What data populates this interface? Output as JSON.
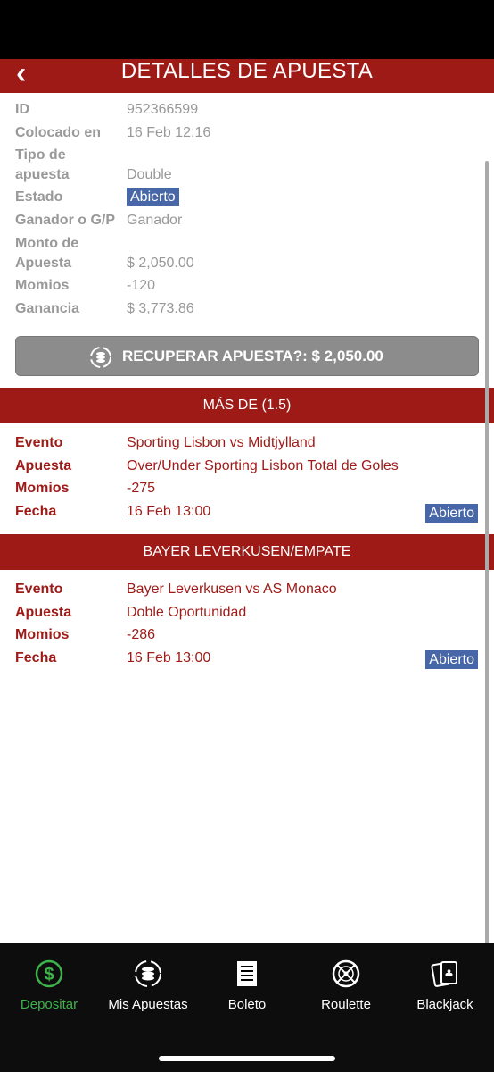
{
  "header": {
    "back_icon": "chevron-left-icon",
    "title": "DETALLES DE APUESTA"
  },
  "details": {
    "id_label": "ID",
    "id_value": "952366599",
    "placed_label": "Colocado en",
    "placed_value": "16 Feb 12:16",
    "type_label_1": "Tipo de",
    "type_label_2": "apuesta",
    "type_value": "Double",
    "status_label": "Estado",
    "status_value": "Abierto",
    "winner_label": "Ganador o G/P",
    "winner_value": "Ganador",
    "amount_label_1": "Monto de",
    "amount_label_2": "Apuesta",
    "amount_value": "$ 2,050.00",
    "odds_label": "Momios",
    "odds_value": "-120",
    "profit_label": "Ganancia",
    "profit_value": "$ 3,773.86"
  },
  "recover_button": {
    "label": "RECUPERAR APUESTA?: $ 2,050.00",
    "icon": "coins-refresh-icon"
  },
  "legs": [
    {
      "header": "MÁS DE (1.5)",
      "event_label": "Evento",
      "event_value": "Sporting Lisbon vs Midtjylland",
      "bet_label": "Apuesta",
      "bet_value": "Over/Under Sporting Lisbon Total de Goles",
      "odds_label": "Momios",
      "odds_value": "-275",
      "date_label": "Fecha",
      "date_value": "16 Feb 13:00",
      "status": "Abierto"
    },
    {
      "header": "BAYER LEVERKUSEN/EMPATE",
      "event_label": "Evento",
      "event_value": "Bayer Leverkusen vs AS Monaco",
      "bet_label": "Apuesta",
      "bet_value": "Doble Oportunidad",
      "odds_label": "Momios",
      "odds_value": "-286",
      "date_label": "Fecha",
      "date_value": "16 Feb 13:00",
      "status": "Abierto"
    }
  ],
  "tabbar": [
    {
      "label": "Depositar",
      "icon": "dollar-circle-icon",
      "active": true
    },
    {
      "label": "Mis Apuestas",
      "icon": "coins-refresh-icon",
      "active": false
    },
    {
      "label": "Boleto",
      "icon": "ticket-list-icon",
      "active": false
    },
    {
      "label": "Roulette",
      "icon": "roulette-wheel-icon",
      "active": false
    },
    {
      "label": "Blackjack",
      "icon": "playing-cards-icon",
      "active": false
    }
  ],
  "colors": {
    "brand_red": "#9e1a17",
    "badge_blue": "#4767a8",
    "active_green": "#3cb44a"
  }
}
